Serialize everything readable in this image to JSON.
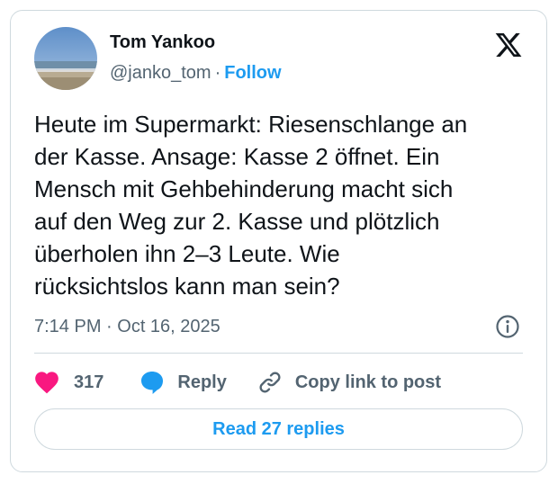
{
  "author": {
    "name": "Tom Yankoo",
    "handle": "@janko_tom",
    "separator": "·",
    "follow_label": "Follow"
  },
  "tweet": {
    "lines": [
      "Heute im Supermarkt: Riesenschlange an",
      "der Kasse. Ansage: Kasse 2 öffnet. Ein",
      "Mensch mit Gehbehinderung macht sich",
      "auf den Weg zur 2. Kasse und plötzlich",
      "überholen ihn 2–3 Leute. Wie",
      "rücksichtslos kann man sein?"
    ],
    "timestamp": "7:14 PM · Oct 16, 2025"
  },
  "actions": {
    "like_count": "317",
    "reply_label": "Reply",
    "copy_link_label": "Copy link to post"
  },
  "read_replies_label": "Read 27 replies",
  "icons": {
    "brand": "x-logo-icon",
    "info": "info-icon",
    "like": "heart-icon",
    "reply": "speech-bubble-icon",
    "copy": "link-icon"
  },
  "colors": {
    "accent": "#1d9bf0",
    "heart": "#f91880",
    "text": "#0f1419",
    "muted": "#536471",
    "border": "#cfd9de"
  }
}
